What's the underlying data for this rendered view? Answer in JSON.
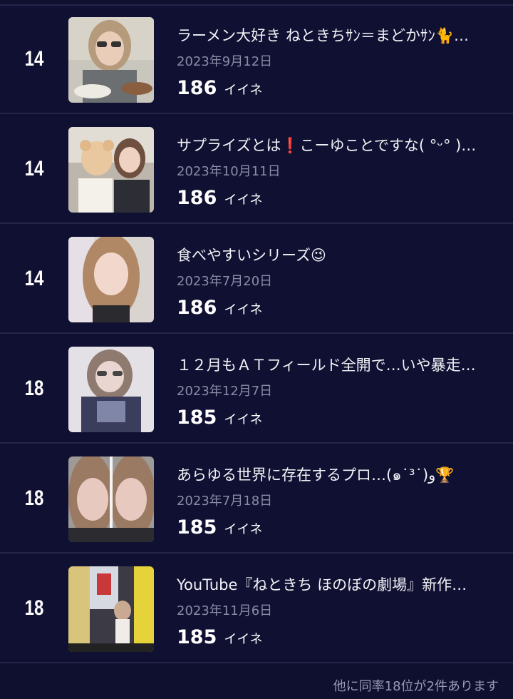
{
  "posts": [
    {
      "rank": "14",
      "title": "ラーメン大好き ねときちｻﾝ＝まどかｻﾝ🐈…",
      "date": "2023年9月12日",
      "likes": "186",
      "likes_unit": "イイネ"
    },
    {
      "rank": "14",
      "title": "サプライズとは❗こーゆことですな( °ᵕ° )…",
      "date": "2023年10月11日",
      "likes": "186",
      "likes_unit": "イイネ"
    },
    {
      "rank": "14",
      "title": "食べやすいシリーズ😉",
      "date": "2023年7月20日",
      "likes": "186",
      "likes_unit": "イイネ"
    },
    {
      "rank": "18",
      "title": "１２月もＡＴフィールド全開で…いや暴走…",
      "date": "2023年12月7日",
      "likes": "185",
      "likes_unit": "イイネ"
    },
    {
      "rank": "18",
      "title": "あらゆる世界に存在するプロ…(๑˙³˙)و🏆",
      "date": "2023年7月18日",
      "likes": "185",
      "likes_unit": "イイネ"
    },
    {
      "rank": "18",
      "title": "YouTube『ねときち ほのぼの劇場』新作…",
      "date": "2023年11月6日",
      "likes": "185",
      "likes_unit": "イイネ"
    }
  ],
  "footer_note": "他に同率18位が2件あります"
}
